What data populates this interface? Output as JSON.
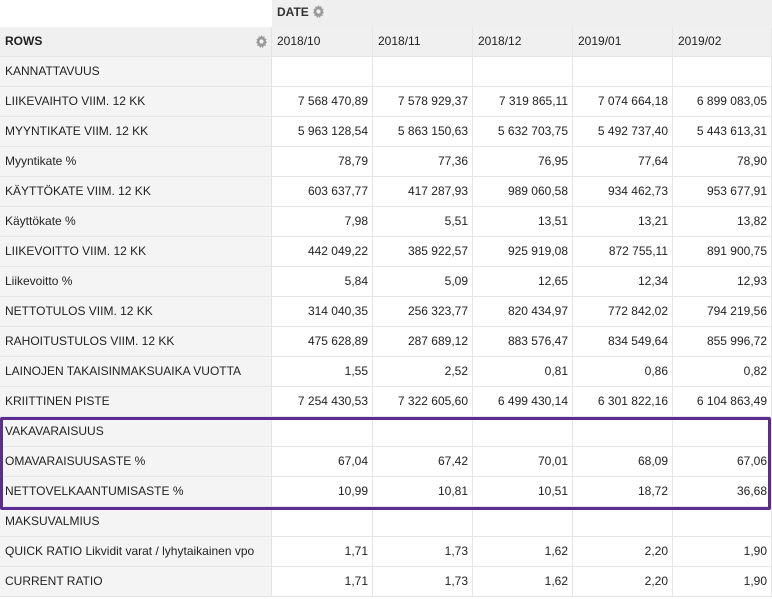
{
  "header": {
    "date_label": "DATE",
    "rows_label": "ROWS",
    "columns": [
      "2018/10",
      "2018/11",
      "2018/12",
      "2019/01",
      "2019/02"
    ]
  },
  "rows": [
    {
      "label": "KANNATTAVUUS",
      "values": [
        "",
        "",
        "",
        "",
        ""
      ]
    },
    {
      "label": "LIIKEVAIHTO VIIM. 12 KK",
      "values": [
        "7 568 470,89",
        "7 578 929,37",
        "7 319 865,11",
        "7 074 664,18",
        "6 899 083,05"
      ]
    },
    {
      "label": "MYYNTIKATE VIIM. 12 KK",
      "values": [
        "5 963 128,54",
        "5 863 150,63",
        "5 632 703,75",
        "5 492 737,40",
        "5 443 613,31"
      ]
    },
    {
      "label": "Myyntikate %",
      "values": [
        "78,79",
        "77,36",
        "76,95",
        "77,64",
        "78,90"
      ]
    },
    {
      "label": "KÄYTTÖKATE VIIM. 12 KK",
      "values": [
        "603 637,77",
        "417 287,93",
        "989 060,58",
        "934 462,73",
        "953 677,91"
      ]
    },
    {
      "label": "Käyttökate %",
      "values": [
        "7,98",
        "5,51",
        "13,51",
        "13,21",
        "13,82"
      ]
    },
    {
      "label": "LIIKEVOITTO VIIM. 12 KK",
      "values": [
        "442 049,22",
        "385 922,57",
        "925 919,08",
        "872 755,11",
        "891 900,75"
      ]
    },
    {
      "label": "Liikevoitto %",
      "values": [
        "5,84",
        "5,09",
        "12,65",
        "12,34",
        "12,93"
      ]
    },
    {
      "label": "NETTOTULOS VIIM. 12 KK",
      "values": [
        "314 040,35",
        "256 323,77",
        "820 434,97",
        "772 842,02",
        "794 219,56"
      ]
    },
    {
      "label": "RAHOITUSTULOS VIIM. 12 KK",
      "values": [
        "475 628,89",
        "287 689,12",
        "883 576,47",
        "834 549,64",
        "855 996,72"
      ]
    },
    {
      "label": "LAINOJEN TAKAISINMAKSUAIKA VUOTTA",
      "values": [
        "1,55",
        "2,52",
        "0,81",
        "0,86",
        "0,82"
      ]
    },
    {
      "label": "KRIITTINEN PISTE",
      "values": [
        "7 254 430,53",
        "7 322 605,60",
        "6 499 430,14",
        "6 301 822,16",
        "6 104 863,49"
      ]
    },
    {
      "label": "VAKAVARAISUUS",
      "values": [
        "",
        "",
        "",
        "",
        ""
      ]
    },
    {
      "label": "OMAVARAISUUSASTE %",
      "values": [
        "67,04",
        "67,42",
        "70,01",
        "68,09",
        "67,06"
      ]
    },
    {
      "label": "NETTOVELKAANTUMISASTE %",
      "values": [
        "10,99",
        "10,81",
        "10,51",
        "18,72",
        "36,68"
      ]
    },
    {
      "label": "MAKSUVALMIUS",
      "values": [
        "",
        "",
        "",
        "",
        ""
      ]
    },
    {
      "label": "QUICK RATIO Likvidit varat / lyhytaikainen vpo",
      "values": [
        "1,71",
        "1,73",
        "1,62",
        "2,20",
        "1,90"
      ]
    },
    {
      "label": "CURRENT RATIO",
      "values": [
        "1,71",
        "1,73",
        "1,62",
        "2,20",
        "1,90"
      ]
    }
  ],
  "highlight": {
    "color": "#5b2c91"
  },
  "icons": {
    "date_settings": "gear-icon",
    "rows_settings": "gear-icon"
  }
}
